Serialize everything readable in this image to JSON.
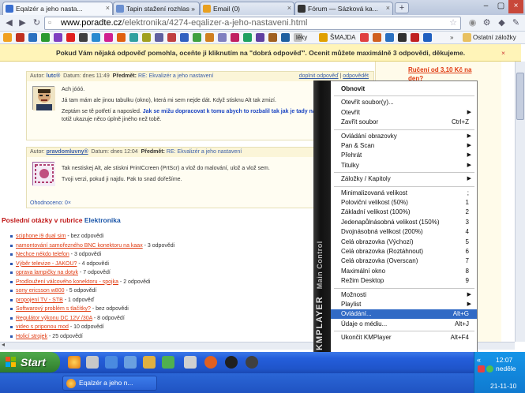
{
  "browser": {
    "tabs": [
      {
        "label": "Eqalzér a jeho nasta...",
        "active": true
      },
      {
        "label": "Tapin stažení rozhlas »",
        "active": false
      },
      {
        "label": "Email (0)",
        "active": false
      },
      {
        "label": "Fórum — Sázková ka...",
        "active": false
      }
    ],
    "url_domain": "www.poradte.cz",
    "url_path": "/elektronika/4274-eqalizer-a-jeho-nastaveni.html",
    "bookmarks": [
      "lěky",
      "ŠMAJDA"
    ],
    "other_bookmarks": "Ostatní záložky"
  },
  "infobar": {
    "message": "Pokud Vám nějaká odpověď pomohla, oceňte ji kliknutím na \"dobrá odpověď\". Ocenit můžete maximálně 3 odpovědi, děkujeme.",
    "close": "×"
  },
  "post1": {
    "author_label": "Autor:",
    "author": "lutc®",
    "date_label": "Datum:",
    "date": "dnes 11:49",
    "subject_label": "Předmět:",
    "subject": "RE: Ekvalizér a jeho nastavení",
    "action_good": "doplnit odpověď",
    "action_reply": "odpovědět",
    "line1": "Ach jóóó.",
    "line2": "Já tam mám ale jinou tabulku (okno), která mi sem nejde dát. Když stisknu Alt tak zmizí.",
    "line3a": "Zeptám se tě potřetí a naposled.",
    "line3b": "Jak se mižu dopracovat k tomu abych to rozbalil tak jak je tady na obrázku?.?.",
    "line3c": "mě to totiž ukazuje něco úplně jiného než tobě."
  },
  "post2": {
    "author_label": "Autor:",
    "author": "pravdomluvny®",
    "date_label": "Datum:",
    "date": "dnes 12:04",
    "subject_label": "Předmět:",
    "subject": "RE: Ekvalizér a jeho nastavení",
    "line1": "Tak nestiskej Alt, ale stiskni PrintCcreen (PrtScr) a vlož do malování, ulož a vlož sem.",
    "line2": "Tvoji verzi, pokud ji najdu. Pak to snad dořešíme.",
    "rating": "Ohodnoceno: 0×"
  },
  "section": {
    "prefix": "Poslední otázky v rubrice",
    "category": "Elektronika"
  },
  "questions": [
    {
      "title": "sciphone i9 dual sim",
      "count": "- bez odpovědi"
    },
    {
      "title": "namontování samořezného BNC konektoru na kaax",
      "count": "- 3 odpovědi"
    },
    {
      "title": "Nechce nékdo telefon",
      "count": "- 3 odpovědi"
    },
    {
      "title": "Výběr televize - JAKOU?",
      "count": "- 4 odpovědi"
    },
    {
      "title": "oprava lampičky na dotyk",
      "count": "- 7 odpovědí"
    },
    {
      "title": "Prodloužení válcového konektoru - spojka",
      "count": "- 2 odpovědi"
    },
    {
      "title": "sony ericsson w800",
      "count": "- 5 odpovědí"
    },
    {
      "title": "propojení TV - STB",
      "count": "- 1 odpověď"
    },
    {
      "title": "Softwarový problém s tlačítky?",
      "count": "- bez odpovědi"
    },
    {
      "title": "Regulátor výkonu DC 12V /30A",
      "count": "- 8 odpovědí"
    },
    {
      "title": "video s priponou mod",
      "count": "- 10 odpovědí"
    },
    {
      "title": "Holicí strojek",
      "count": "- 25 odpovědí"
    }
  ],
  "sidebar": {
    "link": "Ručení od 3,10 Kč na den?"
  },
  "kmplayer": {
    "brand": "KMPLAYER",
    "subtitle": "Main Control"
  },
  "menu": [
    {
      "label": "Obnovit",
      "shortcut": "",
      "arrow": false,
      "bold": true
    },
    {
      "sep": true
    },
    {
      "label": "Otevřít soubor(y)...",
      "shortcut": "",
      "arrow": false
    },
    {
      "label": "Otevřít",
      "shortcut": "",
      "arrow": true
    },
    {
      "label": "Zavřít soubor",
      "shortcut": "Ctrl+Z",
      "arrow": false
    },
    {
      "sep": true
    },
    {
      "label": "Ovládání obrazovky",
      "shortcut": "",
      "arrow": true
    },
    {
      "label": "Pan & Scan",
      "shortcut": "",
      "arrow": true
    },
    {
      "label": "Přehrát",
      "shortcut": "",
      "arrow": true
    },
    {
      "label": "Titulky",
      "shortcut": "",
      "arrow": true
    },
    {
      "sep": true
    },
    {
      "label": "Záložky / Kapitoly",
      "shortcut": "",
      "arrow": true
    },
    {
      "sep": true
    },
    {
      "label": "Minimalizovaná velikost",
      "shortcut": ";",
      "arrow": false
    },
    {
      "label": "Poloviční velikost (50%)",
      "shortcut": "1",
      "arrow": false
    },
    {
      "label": "Základní velikost (100%)",
      "shortcut": "2",
      "arrow": false
    },
    {
      "label": "Jedenapůlnásobná velikost  (150%)",
      "shortcut": "3",
      "arrow": false
    },
    {
      "label": "Dvojnásobná velikost (200%)",
      "shortcut": "4",
      "arrow": false
    },
    {
      "label": "Celá obrazovka (Výchozí)",
      "shortcut": "5",
      "arrow": false
    },
    {
      "label": "Celá obrazovka (Roztáhnout)",
      "shortcut": "6",
      "arrow": false
    },
    {
      "label": "Celá obrazovka (Overscan)",
      "shortcut": "7",
      "arrow": false
    },
    {
      "label": "Maximální okno",
      "shortcut": "8",
      "arrow": false
    },
    {
      "label": "Režim Desktop",
      "shortcut": "9",
      "arrow": false
    },
    {
      "sep": true
    },
    {
      "label": "Možnosti",
      "shortcut": "",
      "arrow": true
    },
    {
      "label": "Playlist",
      "shortcut": "",
      "arrow": true
    },
    {
      "label": "Ovládání...",
      "shortcut": "Alt+G",
      "arrow": false,
      "selected": true
    },
    {
      "label": "Údaje o médiu...",
      "shortcut": "Alt+J",
      "arrow": false
    },
    {
      "sep": true
    },
    {
      "label": "Ukončit KMPlayer",
      "shortcut": "Alt+F4",
      "arrow": false
    }
  ],
  "taskbar": {
    "start": "Start",
    "window": "Eqalzér a jeho n...",
    "time": "12:07",
    "day": "neděle",
    "date": "21-11-10"
  }
}
